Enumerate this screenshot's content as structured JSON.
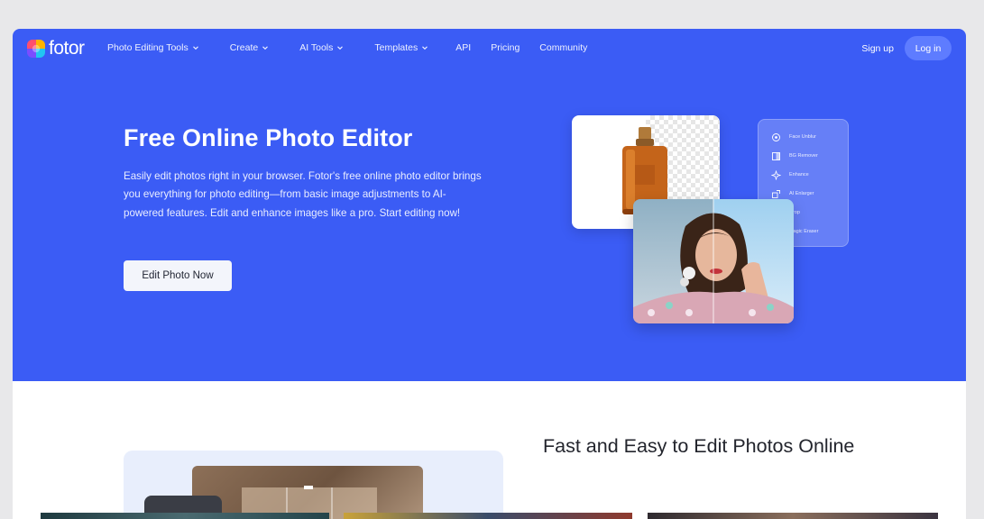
{
  "brand": {
    "name": "fotor"
  },
  "nav": {
    "items": [
      {
        "label": "Photo Editing Tools",
        "has_dropdown": true
      },
      {
        "label": "Create",
        "has_dropdown": true
      },
      {
        "label": "AI Tools",
        "has_dropdown": true
      },
      {
        "label": "Templates",
        "has_dropdown": true
      },
      {
        "label": "API",
        "has_dropdown": false
      },
      {
        "label": "Pricing",
        "has_dropdown": false
      },
      {
        "label": "Community",
        "has_dropdown": false
      }
    ],
    "signup_label": "Sign up",
    "login_label": "Log in"
  },
  "hero": {
    "title": "Free Online Photo Editor",
    "description": "Easily edit photos right in your browser. Fotor's free online photo editor brings you everything for photo editing—from basic image adjustments to AI-powered features. Edit and enhance images like a pro. Start editing now!",
    "cta_label": "Edit Photo Now",
    "tools": [
      {
        "label": "Face Unblur",
        "icon": "face-unblur-icon"
      },
      {
        "label": "BG Remover",
        "icon": "bg-remover-icon"
      },
      {
        "label": "Enhance",
        "icon": "enhance-icon"
      },
      {
        "label": "AI Enlarger",
        "icon": "ai-enlarger-icon"
      },
      {
        "label": "Crop",
        "icon": "crop-icon"
      },
      {
        "label": "Magic Eraser",
        "icon": "magic-eraser-icon"
      }
    ]
  },
  "section2": {
    "title": "Fast and Easy to Edit Photos Online"
  },
  "colors": {
    "hero_bg": "#3b5cf5",
    "login_bg": "#5e7cff",
    "page_bg": "#ffffff"
  }
}
